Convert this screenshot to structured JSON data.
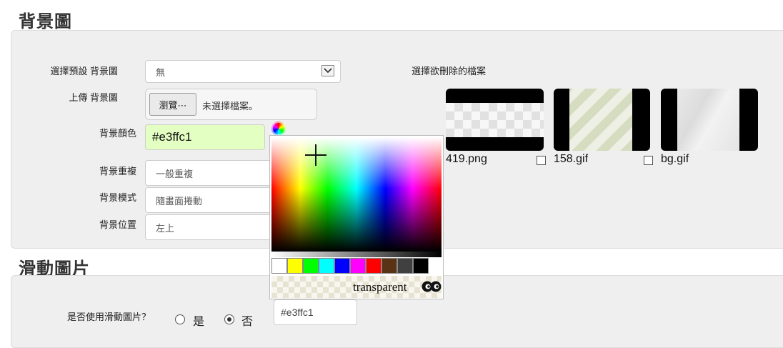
{
  "background_section": {
    "title": "背景圖",
    "preset_label": "選擇預設 背景圖",
    "preset_value": "無",
    "upload_label": "上傳 背景圖",
    "browse_button": "瀏覽⋯",
    "no_file_text": "未選擇檔案。",
    "color_label": "背景顏色",
    "color_value": "#e3ffc1",
    "repeat_label": "背景重複",
    "repeat_value": "一般重複",
    "mode_label": "背景模式",
    "mode_value": "隨畫面捲動",
    "position_label": "背景位置",
    "position_value": "左上",
    "delete_label": "選擇欲刪除的檔案",
    "files": [
      {
        "name": "419.png"
      },
      {
        "name": "158.gif"
      },
      {
        "name": "bg.gif"
      }
    ]
  },
  "color_picker": {
    "transparent_label": "transparent",
    "swatches": [
      "#ffffff",
      "#ffff00",
      "#00ff00",
      "#00ffff",
      "#0000ff",
      "#ff00ff",
      "#ff0000",
      "#5a3214",
      "#404040",
      "#000000"
    ]
  },
  "slider_section": {
    "title": "滑動圖片",
    "use_label": "是否使用滑動圖片？",
    "yes_label": "是",
    "no_label": "否",
    "selected": "否",
    "color_field_value": "#e3ffc1"
  }
}
